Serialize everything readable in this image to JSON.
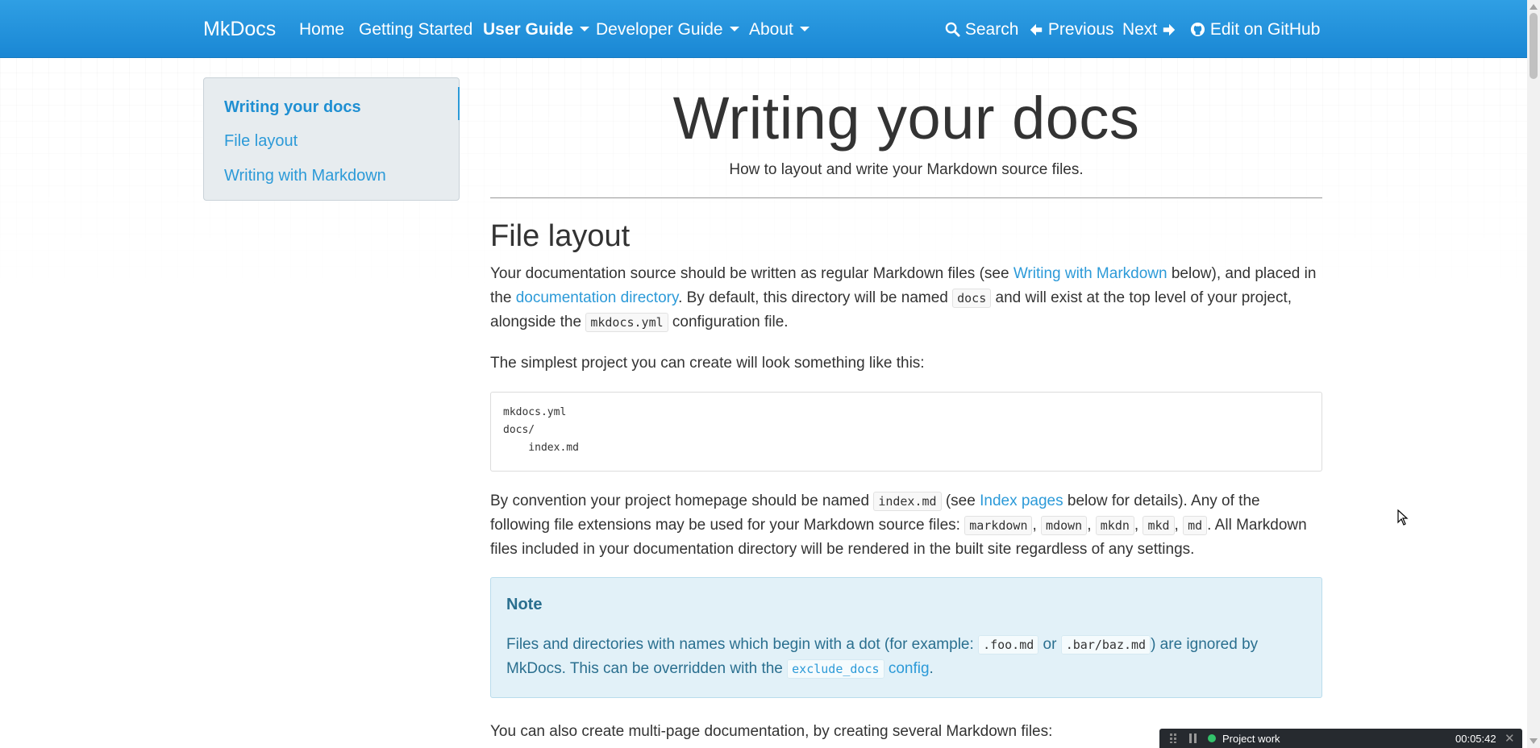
{
  "navbar": {
    "brand": "MkDocs",
    "items": [
      {
        "label": "Home"
      },
      {
        "label": "Getting Started"
      },
      {
        "label": "User Guide"
      },
      {
        "label": "Developer Guide"
      },
      {
        "label": "About"
      }
    ],
    "search_label": "Search",
    "previous_label": "Previous",
    "next_label": "Next",
    "edit_label": "Edit on GitHub",
    "color": "#2196e3"
  },
  "toc": {
    "items": [
      {
        "label": "Writing your docs"
      },
      {
        "label": "File layout"
      },
      {
        "label": "Writing with Markdown"
      }
    ]
  },
  "page": {
    "title": "Writing your docs",
    "subtitle": "How to layout and write your Markdown source files.",
    "section_heading": "File layout",
    "p1": {
      "t1": "Your documentation source should be written as regular Markdown files (see ",
      "link1": "Writing with Markdown",
      "t2": " below), and placed in the ",
      "link2": "documentation directory",
      "t3": ". By default, this directory will be named ",
      "code1": "docs",
      "t4": " and will exist at the top level of your project, alongside the ",
      "code2": "mkdocs.yml",
      "t5": " configuration file."
    },
    "p2": "The simplest project you can create will look something like this:",
    "code_block": "mkdocs.yml\ndocs/\n    index.md",
    "p3": {
      "t1": "By convention your project homepage should be named ",
      "code1": "index.md",
      "t2": " (see ",
      "link1": "Index pages",
      "t3": " below for details). Any of the following file extensions may be used for your Markdown source files: ",
      "ext1": "markdown",
      "ext2": "mdown",
      "ext3": "mkdn",
      "ext4": "mkd",
      "ext5": "md",
      "t4": ". All Markdown files included in your documentation directory will be rendered in the built site regardless of any settings."
    },
    "note": {
      "title": "Note",
      "t1": "Files and directories with names which begin with a dot (for example: ",
      "code1": ".foo.md",
      "t2": " or ",
      "code2": ".bar/baz.md",
      "t3": ") are ignored by MkDocs. This can be overridden with the ",
      "code3": "exclude_docs",
      "link1": "config",
      "t4": "."
    },
    "p4": "You can also create multi-page documentation, by creating several Markdown files:"
  },
  "timer_widget": {
    "label": "Project work",
    "time": "00:05:42",
    "status_color": "#33c36b"
  }
}
